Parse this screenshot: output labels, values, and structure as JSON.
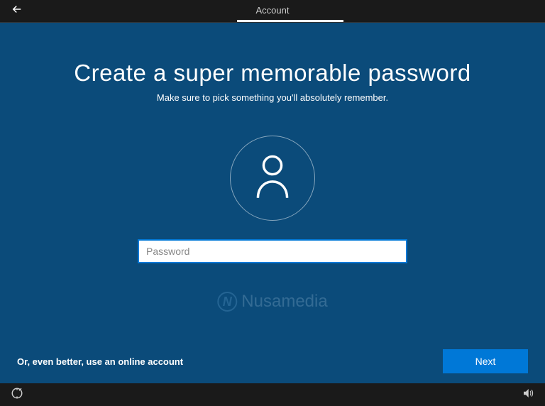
{
  "topbar": {
    "title": "Account"
  },
  "main": {
    "heading": "Create a super memorable password",
    "subheading": "Make sure to pick something you'll absolutely remember.",
    "password_placeholder": "Password",
    "password_value": ""
  },
  "footer": {
    "online_account_link": "Or, even better, use an online account",
    "next_label": "Next"
  },
  "watermark": {
    "text": "Nusamedia",
    "icon_letter": "N"
  },
  "colors": {
    "page_bg": "#0b4b7a",
    "accent": "#0078d7",
    "bar_bg": "#1a1a1a"
  }
}
